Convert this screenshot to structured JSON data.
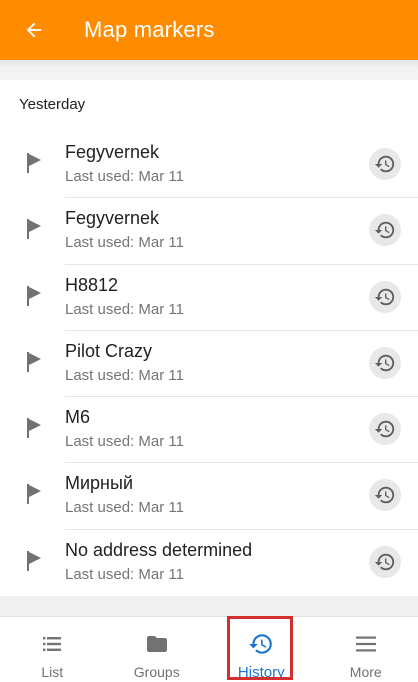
{
  "header": {
    "title": "Map markers",
    "color": "#ff8c00"
  },
  "section": {
    "label": "Yesterday"
  },
  "markers": [
    {
      "name": "Fegyvernek",
      "last_used": "Last used: Mar 11"
    },
    {
      "name": "Fegyvernek",
      "last_used": "Last used: Mar 11"
    },
    {
      "name": "H8812",
      "last_used": "Last used: Mar 11"
    },
    {
      "name": "Pilot Crazy",
      "last_used": "Last used: Mar 11"
    },
    {
      "name": "M6",
      "last_used": "Last used: Mar 11"
    },
    {
      "name": "Мирный",
      "last_used": "Last used: Mar 11"
    },
    {
      "name": "No address determined",
      "last_used": "Last used: Mar 11"
    }
  ],
  "icons": {
    "back": "arrow-left-icon",
    "marker": "flag-icon",
    "restore": "history-restore-icon"
  },
  "bottom_nav": {
    "items": [
      {
        "label": "List",
        "icon": "list-icon"
      },
      {
        "label": "Groups",
        "icon": "folder-icon"
      },
      {
        "label": "History",
        "icon": "history-icon",
        "active": true
      },
      {
        "label": "More",
        "icon": "menu-icon"
      }
    ],
    "active_color": "#1976d2",
    "highlight_color": "#d32f2f"
  }
}
